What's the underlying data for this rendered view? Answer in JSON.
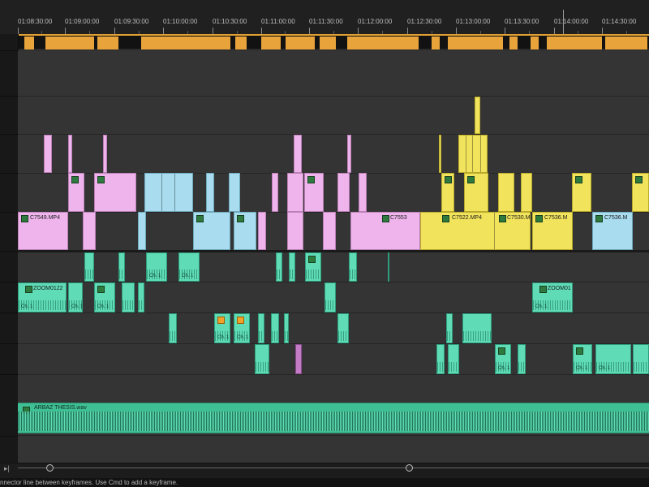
{
  "ruler": {
    "timecodes": [
      "01:08:30:00",
      "01:09:00:00",
      "01:09:30:00",
      "01:10:00:00",
      "01:10:30:00",
      "01:11:00:00",
      "01:11:30:00",
      "01:12:00:00",
      "01:12:30:00",
      "01:13:00:00",
      "01:13:30:00",
      "01:14:00:00",
      "01:14:30:00"
    ]
  },
  "clips": {
    "v1_c7549": "C7549.MP4",
    "v1_c7553": "C7553",
    "v1_c7522": "C7522.MP4",
    "v1_c7530": "C7530.M",
    "v1_c7536a": "C7536.M",
    "v1_c7536b": "C7536.M",
    "a1_zoom0122": "ZOOM0122",
    "a1_zoom01": "ZOOM01",
    "channel_label": "Ch. 1"
  },
  "master_audio": {
    "name": "ARBAZ THESIS.wav"
  },
  "status": {
    "text": "nnector line between keyframes. Use Cmd to add a keyframe."
  },
  "colors": {
    "render_bar": "#e8a33a",
    "video_pink": "#efb4ec",
    "video_blue": "#a8dcee",
    "video_yellow": "#f2e35c",
    "audio_teal": "#5fdcb6"
  }
}
